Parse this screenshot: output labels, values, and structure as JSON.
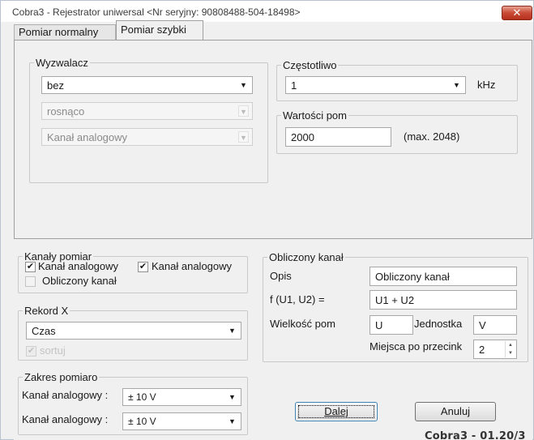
{
  "window": {
    "title": "Cobra3 - Rejestrator uniwersal  <Nr seryjny: 90808488-504-18498>",
    "close_symbol": "✕"
  },
  "tabs": [
    {
      "label": "Pomiar normalny",
      "active": false
    },
    {
      "label": "Pomiar szybki",
      "active": true
    }
  ],
  "trigger": {
    "legend": "Wyzwalacz",
    "mode": "bez",
    "edge": "rosnąco",
    "channel": "Kanał analogowy"
  },
  "frequency": {
    "legend": "Częstotliwo",
    "value": "1",
    "unit": "kHz"
  },
  "samples": {
    "legend": "Wartości pom",
    "value": "2000",
    "max_note": "(max. 2048)"
  },
  "channels": {
    "legend": "Kanały pomiar",
    "items": [
      {
        "label": "Kanał analogowy",
        "checked": true
      },
      {
        "label": "Kanał analogowy",
        "checked": true
      },
      {
        "label": "Obliczony kanał",
        "checked": false
      }
    ]
  },
  "record_x": {
    "legend": "Rekord X",
    "value": "Czas",
    "sort_label": "sortuj",
    "sort_checked": true
  },
  "range": {
    "legend": "Zakres pomiaro",
    "rows": [
      {
        "label": "Kanał analogowy :",
        "value": "± 10 V"
      },
      {
        "label": "Kanał analogowy :",
        "value": "± 10 V"
      }
    ]
  },
  "computed": {
    "legend": "Obliczony kanał",
    "desc_label": "Opis",
    "desc_value": "Obliczony kanał",
    "func_label": "f (U1, U2) =",
    "func_value": "U1 + U2",
    "quantity_label": "Wielkość pom",
    "quantity_value": "U",
    "unit_label": "Jednostka",
    "unit_value": "V",
    "decimals_label": "Miejsca po przecink",
    "decimals_value": "2"
  },
  "buttons": {
    "next": "Dalej",
    "cancel": "Anuluj"
  },
  "version": "Cobra3 - 01.20/3"
}
